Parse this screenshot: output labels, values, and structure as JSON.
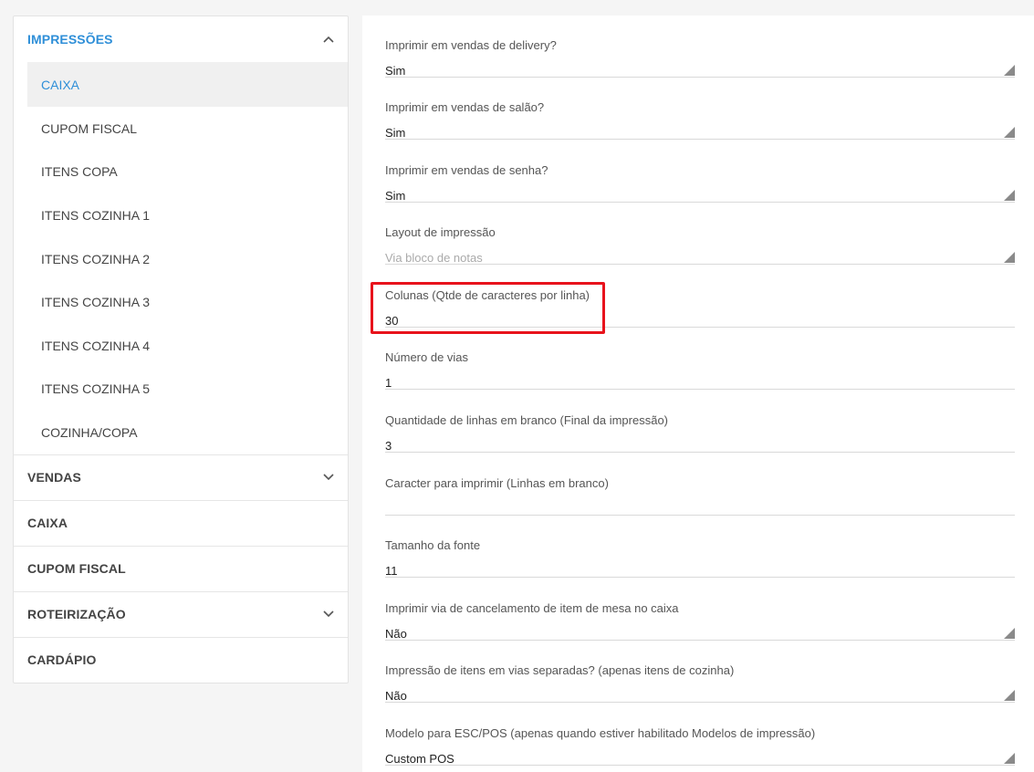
{
  "sidebar": {
    "sections": [
      {
        "label": "IMPRESSÕES",
        "chevron": "chevron-up-icon",
        "items": [
          {
            "label": "CAIXA"
          },
          {
            "label": "CUPOM FISCAL"
          },
          {
            "label": "ITENS COPA"
          },
          {
            "label": "ITENS COZINHA 1"
          },
          {
            "label": "ITENS COZINHA 2"
          },
          {
            "label": "ITENS COZINHA 3"
          },
          {
            "label": "ITENS COZINHA 4"
          },
          {
            "label": "ITENS COZINHA 5"
          },
          {
            "label": "COZINHA/COPA"
          }
        ]
      },
      {
        "label": "VENDAS",
        "chevron": "chevron-down-icon"
      },
      {
        "label": "CAIXA"
      },
      {
        "label": "CUPOM FISCAL"
      },
      {
        "label": "ROTEIRIZAÇÃO",
        "chevron": "chevron-down-icon"
      },
      {
        "label": "CARDÁPIO"
      }
    ]
  },
  "form": {
    "fields": [
      {
        "label": "Imprimir em vendas de delivery?",
        "value": "Sim",
        "type": "select"
      },
      {
        "label": "Imprimir em vendas de salão?",
        "value": "Sim",
        "type": "select"
      },
      {
        "label": "Imprimir em vendas de senha?",
        "value": "Sim",
        "type": "select"
      },
      {
        "label": "Layout de impressão",
        "value": "Via bloco de notas",
        "type": "select"
      },
      {
        "label": "Colunas (Qtde de caracteres por linha)",
        "value": "30",
        "type": "input"
      },
      {
        "label": "Número de vias",
        "value": "1",
        "type": "input"
      },
      {
        "label": "Quantidade de linhas em branco (Final da impressão)",
        "value": "3",
        "type": "input"
      },
      {
        "label": "Caracter para imprimir (Linhas em branco)",
        "value": "",
        "type": "input"
      },
      {
        "label": "Tamanho da fonte",
        "value": "11",
        "type": "input"
      },
      {
        "label": "Imprimir via de cancelamento de item de mesa no caixa",
        "value": "Não",
        "type": "select"
      },
      {
        "label": "Impressão de itens em vias separadas? (apenas itens de cozinha)",
        "value": "Não",
        "type": "select"
      },
      {
        "label": "Modelo para ESC/POS (apenas quando estiver habilitado Modelos de impressão)",
        "value": "Custom POS",
        "type": "select"
      }
    ]
  },
  "colors": {
    "accent": "#2f8fd8",
    "highlight_border": "#e8131c"
  }
}
